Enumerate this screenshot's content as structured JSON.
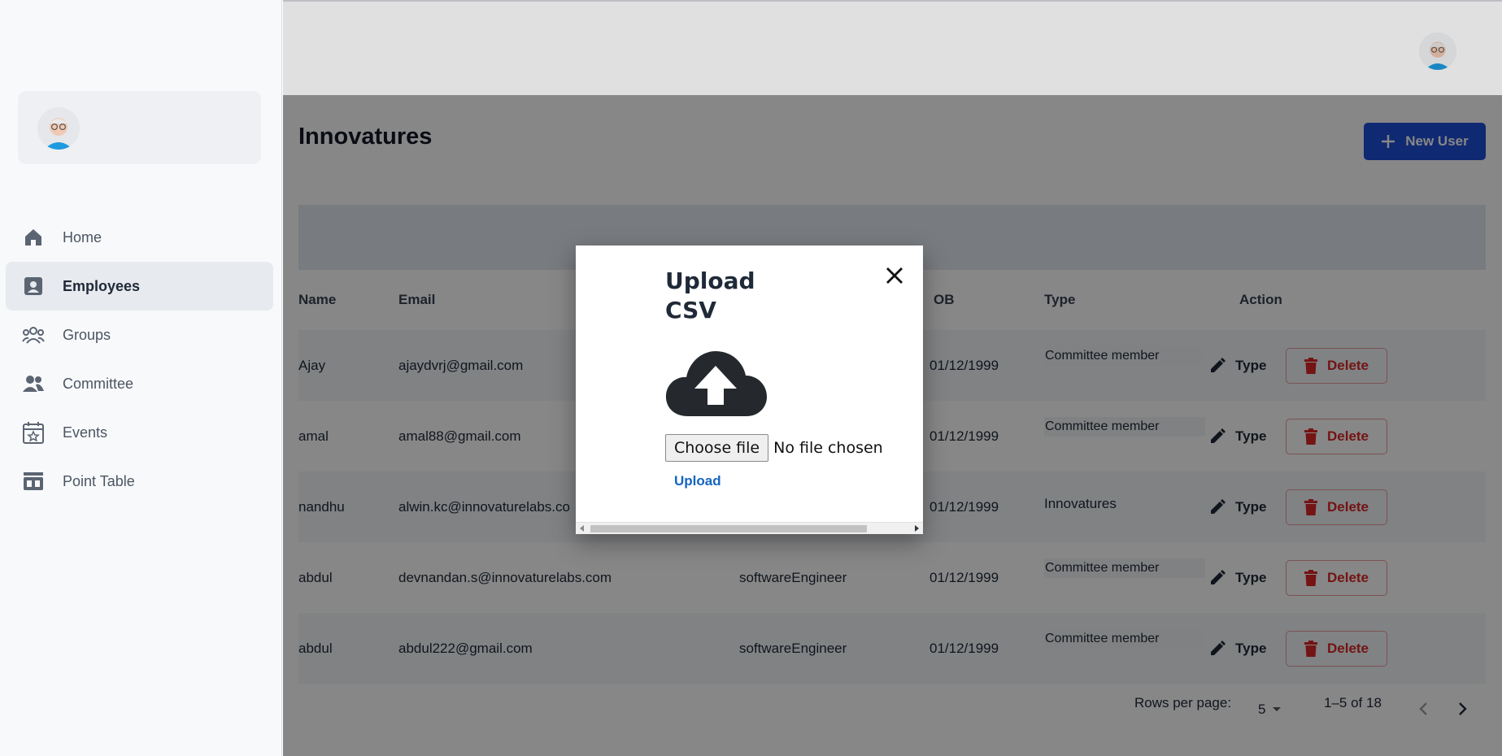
{
  "colors": {
    "primary": "#1d4ed8",
    "danger": "#dc2626",
    "link": "#1565c0"
  },
  "sidebar": {
    "items": [
      {
        "label": "Home",
        "icon": "home-icon"
      },
      {
        "label": "Employees",
        "icon": "badge-icon",
        "active": true
      },
      {
        "label": "Groups",
        "icon": "groups-icon"
      },
      {
        "label": "Committee",
        "icon": "people-icon"
      },
      {
        "label": "Events",
        "icon": "calendar-star-icon"
      },
      {
        "label": "Point Table",
        "icon": "scoreboard-icon"
      }
    ]
  },
  "main": {
    "title": "Innovatures",
    "new_user_label": "New User",
    "columns": {
      "name": "Name",
      "email": "Email",
      "dob": "OB",
      "type": "Type",
      "action": "Action"
    },
    "rows": [
      {
        "name": "Ajay",
        "email": "ajaydvrj@gmail.com",
        "designation": "",
        "dob": "01/12/1999",
        "type": "Committee member",
        "type_action": "Type",
        "delete": "Delete"
      },
      {
        "name": "amal",
        "email": "amal88@gmail.com",
        "designation": "",
        "dob": "01/12/1999",
        "type": "Committee member",
        "type_action": "Type",
        "delete": "Delete"
      },
      {
        "name": "nandhu",
        "email": "alwin.kc@innovaturelabs.co",
        "designation": "",
        "dob": "01/12/1999",
        "type": "Innovatures",
        "type_action": "Type",
        "delete": "Delete"
      },
      {
        "name": "abdul",
        "email": "devnandan.s@innovaturelabs.com",
        "designation": "softwareEngineer",
        "dob": "01/12/1999",
        "type": "Committee member",
        "type_action": "Type",
        "delete": "Delete"
      },
      {
        "name": "abdul",
        "email": "abdul222@gmail.com",
        "designation": "softwareEngineer",
        "dob": "01/12/1999",
        "type": "Committee member",
        "type_action": "Type",
        "delete": "Delete"
      }
    ],
    "pagination": {
      "rows_per_page_label": "Rows per page:",
      "rows_per_page": "5",
      "range": "1–5 of 18"
    }
  },
  "modal": {
    "title": "Upload CSV",
    "choose_file_label": "Choose file",
    "no_file_label": "No file chosen",
    "upload_label": "Upload"
  }
}
